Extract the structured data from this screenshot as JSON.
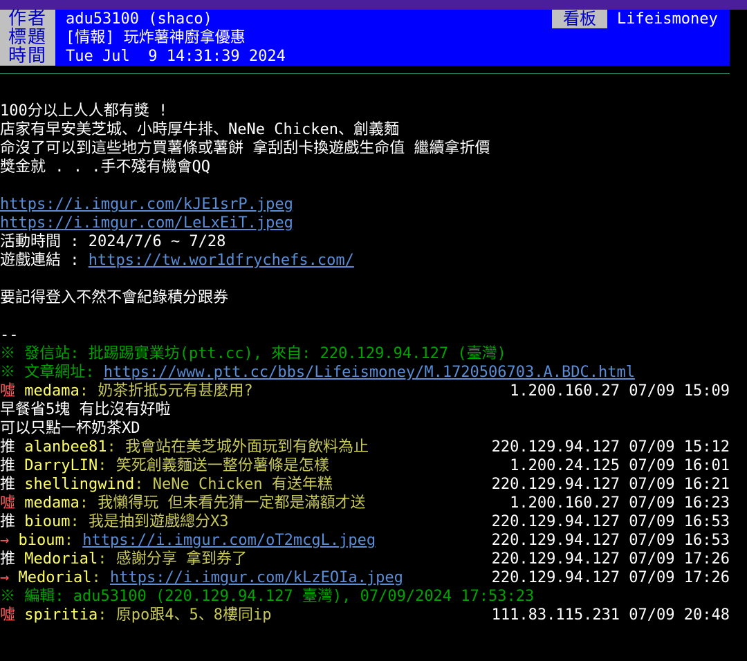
{
  "header": {
    "author_label": "作者",
    "author": "adu53100 (shaco)",
    "board_label": "看板",
    "board": "Lifeismoney",
    "title_label": "標題",
    "title": "[情報] 玩炸薯神廚拿優惠",
    "time_label": "時間",
    "time": "Tue Jul  9 14:31:39 2024"
  },
  "body": {
    "line1": "100分以上人人都有獎 !",
    "line2": "店家有早安美芝城、小時厚牛排、NeNe Chicken、創義麵",
    "line3": "命沒了可以到這些地方買薯條或薯餅 拿刮刮卡換遊戲生命值 繼續拿折價",
    "line4": "獎金就 . . .手不殘有機會QQ",
    "link1": "https://i.imgur.com/kJE1srP.jpeg",
    "link2": "https://i.imgur.com/LeLxEiT.jpeg",
    "event_label": "活動時間 : 2024/7/6 ~ 7/28",
    "game_label": "遊戲連結 : ",
    "game_link": "https://tw.wor1dfrychefs.com/",
    "note": "要記得登入不然不會紀錄積分跟券",
    "sig": "--"
  },
  "footer": {
    "site": "※ 發信站: 批踢踢實業坊(ptt.cc), 來自: 220.129.94.127 (臺灣)",
    "url_label": "※ 文章網址: ",
    "url": "https://www.ptt.cc/bbs/Lifeismoney/M.1720506703.A.BDC.html"
  },
  "comments": [
    {
      "tag": "噓",
      "user": "medama",
      "text": "奶茶折抵5元有甚麼用?",
      "meta": "1.200.160.27 07/09 15:09",
      "type": "boo"
    },
    {
      "plain": "早餐省5塊 有比沒有好啦"
    },
    {
      "plain": "可以只點一杯奶茶XD"
    },
    {
      "tag": "推",
      "user": "alanbee81",
      "text": "我會站在美芝城外面玩到有飲料為止",
      "meta": "220.129.94.127 07/09 15:12",
      "type": "push"
    },
    {
      "tag": "推",
      "user": "DarryLIN",
      "text": "笑死創義麵送一整份薯條是怎樣",
      "meta": "1.200.24.125 07/09 16:01",
      "type": "push"
    },
    {
      "tag": "推",
      "user": "shellingwind",
      "text": "NeNe Chicken 有送年糕",
      "meta": "220.129.94.127 07/09 16:21",
      "type": "push"
    },
    {
      "tag": "噓",
      "user": "medama",
      "text": "我懶得玩 但未看先猜一定都是滿額才送",
      "meta": "1.200.160.27 07/09 16:23",
      "type": "boo"
    },
    {
      "tag": "推",
      "user": "bioum",
      "text": "我是抽到遊戲總分X3",
      "meta": "220.129.94.127 07/09 16:53",
      "type": "push"
    },
    {
      "tag": "→",
      "user": "bioum",
      "text": "https://i.imgur.com/oT2mcgL.jpeg",
      "meta": "220.129.94.127 07/09 16:53",
      "type": "arrow",
      "link": true
    },
    {
      "tag": "推",
      "user": "Medorial",
      "text": "感謝分享 拿到券了",
      "meta": "220.129.94.127 07/09 17:26",
      "type": "push"
    },
    {
      "tag": "→",
      "user": "Medorial",
      "text": "https://i.imgur.com/kLzEOIa.jpeg",
      "meta": "220.129.94.127 07/09 17:26",
      "type": "arrow",
      "link": true
    },
    {
      "edit": "※ 編輯: adu53100 (220.129.94.127 臺灣), 07/09/2024 17:53:23"
    },
    {
      "tag": "噓",
      "user": "spiritia",
      "text": "原po跟4、5、8樓同ip",
      "meta": "111.83.115.231 07/09 20:48",
      "type": "boo"
    }
  ]
}
